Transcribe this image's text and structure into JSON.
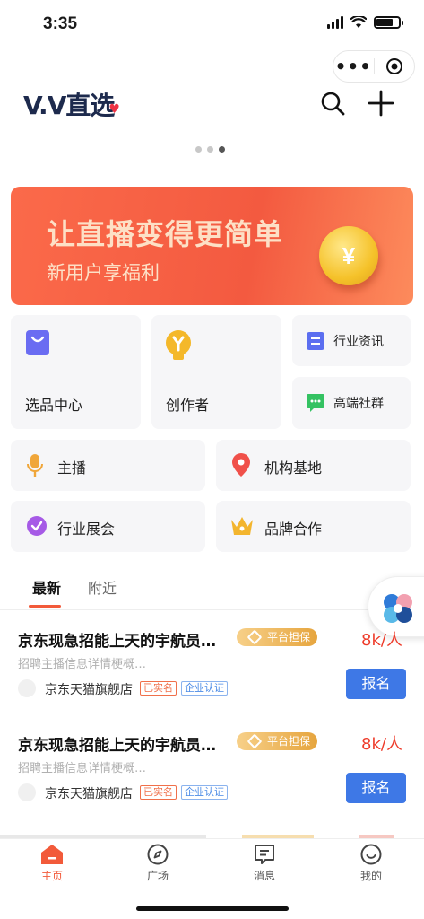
{
  "status_bar": {
    "time": "3:35"
  },
  "header": {
    "logo_text": "V.V直选"
  },
  "banner": {
    "title": "让直播变得更简单",
    "subtitle": "新用户享福利",
    "coin_symbol": "¥"
  },
  "grid": {
    "selection_center": "选品中心",
    "creator": "创作者",
    "industry_news": "行业资讯",
    "premium_group": "高端社群",
    "anchor": "主播",
    "agency_base": "机构基地",
    "industry_expo": "行业展会",
    "brand_cooperation": "品牌合作"
  },
  "tabs": {
    "latest": "最新",
    "nearby": "附近"
  },
  "jobs": [
    {
      "title": "京东现急招能上天的宇航员…",
      "guarantee": "平台担保",
      "salary": "8k/人",
      "desc": "招聘主播信息详情梗概…",
      "shop": "京东天猫旗舰店",
      "badge_verified": "已实名",
      "badge_company": "企业认证",
      "apply": "报名"
    },
    {
      "title": "京东现急招能上天的宇航员…",
      "guarantee": "平台担保",
      "salary": "8k/人",
      "desc": "招聘主播信息详情梗概…",
      "shop": "京东天猫旗舰店",
      "badge_verified": "已实名",
      "badge_company": "企业认证",
      "apply": "报名"
    }
  ],
  "nav": {
    "home": "主页",
    "plaza": "广场",
    "messages": "消息",
    "mine": "我的"
  },
  "colors": {
    "accent": "#f25a3a",
    "primary_button": "#3e78e6",
    "salary": "#ee3b2a"
  }
}
